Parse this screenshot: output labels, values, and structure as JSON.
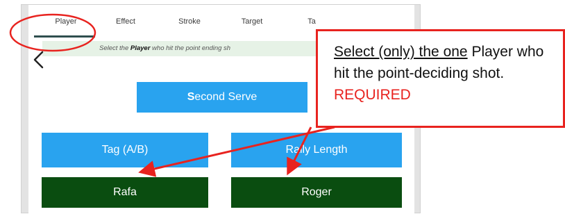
{
  "tabs": [
    {
      "label": "Player",
      "active": true
    },
    {
      "label": "Effect",
      "active": false
    },
    {
      "label": "Stroke",
      "active": false
    },
    {
      "label": "Target",
      "active": false
    },
    {
      "label": "Ta",
      "active": false
    }
  ],
  "instruction": {
    "prefix": "Select the ",
    "emphasis": "Player",
    "suffix": " who hit the point ending sh"
  },
  "buttons": {
    "second_serve_first": "S",
    "second_serve_rest": "econd Serve",
    "tag": "Tag (A/B)",
    "rally_length": "Rally Length",
    "player_a": "Rafa",
    "player_b": "Roger"
  },
  "callout": {
    "underlined": "Select (only) the one",
    "normal": " Player who hit the point-deciding shot. ",
    "required": "REQUIRED"
  },
  "colors": {
    "annotation_red": "#e8231f",
    "button_blue": "#29a3ef",
    "button_green": "#0a4d10",
    "instruction_bg": "#e6f2e6"
  }
}
